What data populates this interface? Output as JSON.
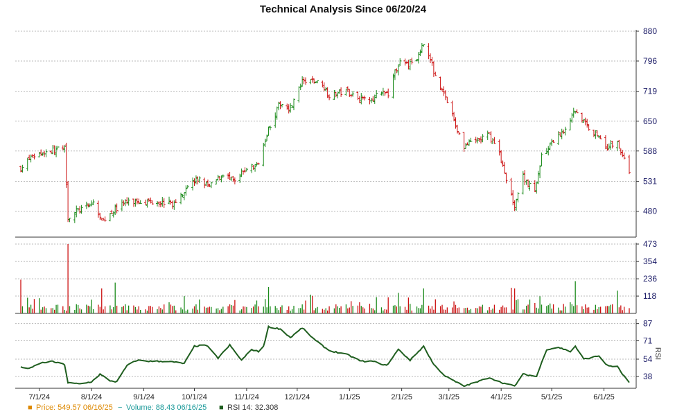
{
  "chart_data": {
    "type": "line",
    "title": "Technical Analysis Since 06/20/24",
    "x_tick_labels": [
      "7/1/24",
      "8/1/24",
      "9/1/24",
      "10/1/24",
      "11/1/24",
      "12/1/24",
      "1/1/25",
      "2/1/25",
      "3/1/25",
      "4/1/25",
      "5/1/25",
      "6/1/25"
    ],
    "panels": [
      {
        "name": "price",
        "chart_kind": "ohlc",
        "y_ticks": [
          480,
          531,
          588,
          650,
          719,
          796,
          880
        ],
        "scale": "log",
        "ylim": [
          440,
          880
        ],
        "grid": true
      },
      {
        "name": "volume",
        "chart_kind": "bar",
        "y_ticks": [
          118,
          236,
          354,
          473
        ],
        "ylim": [
          0,
          473
        ],
        "grid": true
      },
      {
        "name": "rsi",
        "chart_kind": "line",
        "ylabel": "RSI",
        "y_ticks": [
          38,
          54,
          71,
          87
        ],
        "ylim": [
          27,
          90
        ],
        "grid": true
      }
    ],
    "series": [
      {
        "name": "Price",
        "panel": "price",
        "color": "#dd8800",
        "up_color": "#1a8a1a",
        "down_color": "#cc1111",
        "anchors": [
          [
            "2024-06-20",
            555
          ],
          [
            "2024-06-27",
            578
          ],
          [
            "2024-07-03",
            585
          ],
          [
            "2024-07-10",
            590
          ],
          [
            "2024-07-16",
            592
          ],
          [
            "2024-07-18",
            470
          ],
          [
            "2024-07-23",
            480
          ],
          [
            "2024-07-30",
            488
          ],
          [
            "2024-08-02",
            495
          ],
          [
            "2024-08-07",
            462
          ],
          [
            "2024-08-12",
            478
          ],
          [
            "2024-08-20",
            493
          ],
          [
            "2024-08-30",
            497
          ],
          [
            "2024-09-10",
            496
          ],
          [
            "2024-09-20",
            492
          ],
          [
            "2024-09-27",
            525
          ],
          [
            "2024-10-04",
            535
          ],
          [
            "2024-10-10",
            520
          ],
          [
            "2024-10-18",
            545
          ],
          [
            "2024-10-25",
            528
          ],
          [
            "2024-11-01",
            556
          ],
          [
            "2024-11-07",
            558
          ],
          [
            "2024-11-14",
            635
          ],
          [
            "2024-11-21",
            690
          ],
          [
            "2024-11-27",
            680
          ],
          [
            "2024-12-04",
            740
          ],
          [
            "2024-12-10",
            745
          ],
          [
            "2024-12-16",
            735
          ],
          [
            "2024-12-20",
            710
          ],
          [
            "2024-12-31",
            720
          ],
          [
            "2025-01-07",
            700
          ],
          [
            "2025-01-15",
            705
          ],
          [
            "2025-01-24",
            715
          ],
          [
            "2025-01-30",
            790
          ],
          [
            "2025-02-05",
            785
          ],
          [
            "2025-02-11",
            810
          ],
          [
            "2025-02-14",
            850
          ],
          [
            "2025-02-20",
            770
          ],
          [
            "2025-02-27",
            705
          ],
          [
            "2025-03-05",
            640
          ],
          [
            "2025-03-10",
            598
          ],
          [
            "2025-03-18",
            610
          ],
          [
            "2025-03-25",
            620
          ],
          [
            "2025-03-31",
            585
          ],
          [
            "2025-04-04",
            530
          ],
          [
            "2025-04-09",
            490
          ],
          [
            "2025-04-14",
            540
          ],
          [
            "2025-04-21",
            510
          ],
          [
            "2025-04-25",
            580
          ],
          [
            "2025-05-01",
            600
          ],
          [
            "2025-05-08",
            630
          ],
          [
            "2025-05-15",
            675
          ],
          [
            "2025-05-22",
            640
          ],
          [
            "2025-05-29",
            618
          ],
          [
            "2025-06-03",
            595
          ],
          [
            "2025-06-09",
            605
          ],
          [
            "2025-06-12",
            580
          ],
          [
            "2025-06-16",
            549.57
          ]
        ]
      },
      {
        "name": "Volume",
        "panel": "volume",
        "color": "#1a9999",
        "spikes": [
          [
            "2024-06-20",
            230
          ],
          [
            "2024-07-18",
            473
          ],
          [
            "2024-08-07",
            170
          ],
          [
            "2024-08-15",
            210
          ],
          [
            "2024-11-14",
            180
          ],
          [
            "2025-01-30",
            140
          ],
          [
            "2025-02-14",
            170
          ],
          [
            "2025-04-07",
            175
          ],
          [
            "2025-04-09",
            170
          ],
          [
            "2025-05-15",
            220
          ],
          [
            "2025-06-09",
            155
          ]
        ]
      },
      {
        "name": "RSI 14",
        "panel": "rsi",
        "color": "#1f5e1f",
        "anchors": [
          [
            "2024-06-20",
            47
          ],
          [
            "2024-06-25",
            45
          ],
          [
            "2024-07-01",
            50
          ],
          [
            "2024-07-08",
            52
          ],
          [
            "2024-07-16",
            49
          ],
          [
            "2024-07-18",
            32
          ],
          [
            "2024-07-25",
            31
          ],
          [
            "2024-08-01",
            33
          ],
          [
            "2024-08-06",
            40
          ],
          [
            "2024-08-12",
            34
          ],
          [
            "2024-08-16",
            33
          ],
          [
            "2024-08-22",
            48
          ],
          [
            "2024-08-28",
            53
          ],
          [
            "2024-09-05",
            52
          ],
          [
            "2024-09-15",
            52
          ],
          [
            "2024-09-25",
            50
          ],
          [
            "2024-10-01",
            66
          ],
          [
            "2024-10-08",
            67
          ],
          [
            "2024-10-15",
            55
          ],
          [
            "2024-10-22",
            67
          ],
          [
            "2024-10-29",
            53
          ],
          [
            "2024-11-04",
            63
          ],
          [
            "2024-11-10",
            60
          ],
          [
            "2024-11-14",
            84
          ],
          [
            "2024-11-21",
            82
          ],
          [
            "2024-11-27",
            74
          ],
          [
            "2024-12-04",
            83
          ],
          [
            "2024-12-12",
            71
          ],
          [
            "2024-12-20",
            62
          ],
          [
            "2024-12-31",
            58
          ],
          [
            "2025-01-08",
            52
          ],
          [
            "2025-01-15",
            52
          ],
          [
            "2025-01-23",
            48
          ],
          [
            "2025-01-30",
            63
          ],
          [
            "2025-02-06",
            53
          ],
          [
            "2025-02-14",
            66
          ],
          [
            "2025-02-20",
            49
          ],
          [
            "2025-02-27",
            38
          ],
          [
            "2025-03-05",
            33
          ],
          [
            "2025-03-10",
            29
          ],
          [
            "2025-03-18",
            33
          ],
          [
            "2025-03-25",
            37
          ],
          [
            "2025-03-31",
            33
          ],
          [
            "2025-04-04",
            31
          ],
          [
            "2025-04-09",
            29
          ],
          [
            "2025-04-14",
            40
          ],
          [
            "2025-04-22",
            38
          ],
          [
            "2025-04-28",
            63
          ],
          [
            "2025-05-05",
            65
          ],
          [
            "2025-05-12",
            61
          ],
          [
            "2025-05-15",
            66
          ],
          [
            "2025-05-20",
            54
          ],
          [
            "2025-05-29",
            57
          ],
          [
            "2025-06-03",
            48
          ],
          [
            "2025-06-09",
            47
          ],
          [
            "2025-06-12",
            40
          ],
          [
            "2025-06-16",
            32.308
          ]
        ]
      }
    ]
  },
  "legend": {
    "price": {
      "marker": "■",
      "label": "Price: 549.57  06/16/25",
      "color": "#dd8800"
    },
    "volume": {
      "marker": "−",
      "label": "Volume: 88.43  06/16/25",
      "color": "#1a9999"
    },
    "rsi": {
      "marker": "■",
      "label": "RSI 14: 32.308",
      "color": "#1f5e1f",
      "text_color": "#333333"
    }
  }
}
